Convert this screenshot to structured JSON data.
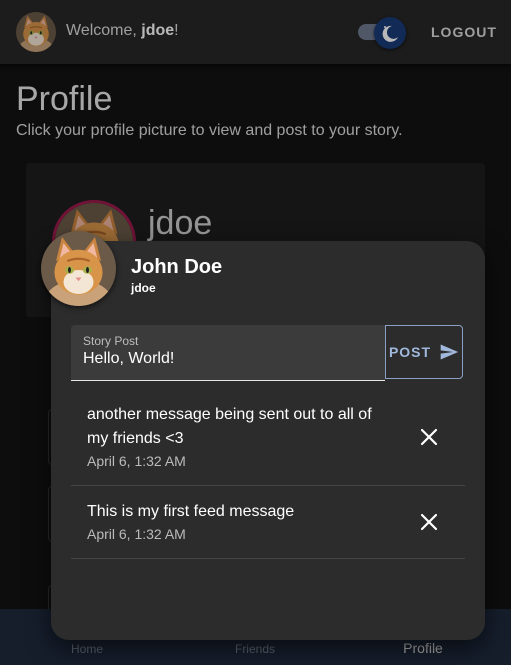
{
  "header": {
    "welcome_prefix": "Welcome, ",
    "username": "jdoe",
    "welcome_suffix": "!",
    "logout_label": "LOGOUT"
  },
  "page": {
    "title": "Profile",
    "subtitle": "Click your profile picture to view and post to your story."
  },
  "profile_card": {
    "username": "jdoe"
  },
  "dialog": {
    "full_name": "John Doe",
    "username": "jdoe",
    "story_field": {
      "label": "Story Post",
      "value": "Hello, World!"
    },
    "post_label": "POST",
    "feed": [
      {
        "text": "another message being sent out to all of my friends <3",
        "time": "April 6, 1:32 AM"
      },
      {
        "text": "This is my first feed message",
        "time": "April 6, 1:32 AM"
      }
    ]
  },
  "bottom_nav": {
    "items": [
      {
        "label": "Home",
        "active": false
      },
      {
        "label": "Friends",
        "active": false
      },
      {
        "label": "Profile",
        "active": true
      }
    ]
  },
  "colors": {
    "app_bar": "#272727",
    "background": "#121212",
    "dialog": "#2c2c2c",
    "avatar_ring": "#9c1b4d",
    "toggle_thumb": "#1a3b78",
    "nav_bar": "#1f2a3d",
    "post_button": "#9fb8dc"
  },
  "icons": {
    "theme_toggle": "moon-icon",
    "post": "send-icon",
    "delete": "close-icon"
  }
}
